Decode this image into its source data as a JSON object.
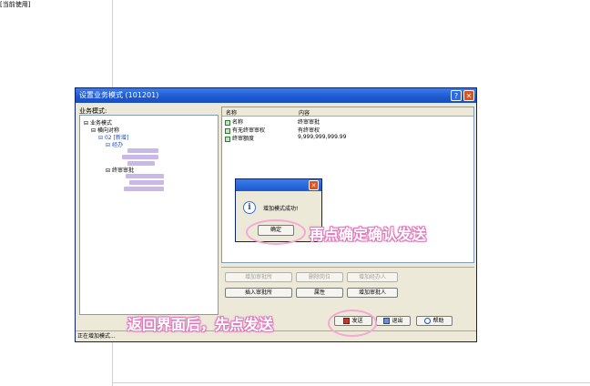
{
  "background": {
    "top_label": "[当前使用]"
  },
  "dialog": {
    "title": "设置业务模式 (101201)",
    "help_glyph": "?",
    "close_glyph": "✕",
    "tree_label": "业务模式:",
    "tree": [
      "业务模式",
      "横向对称",
      "02 [新增]",
      "经办",
      "终审审批"
    ],
    "grid": {
      "columns": [
        "名称",
        "内容"
      ],
      "rows": [
        {
          "name": "名称",
          "value": "终审审批"
        },
        {
          "name": "有无终审审权",
          "value": "有终审权"
        },
        {
          "name": "终审额度",
          "value": "9,999,999,999.99"
        }
      ]
    },
    "buttons_disabled": [
      "增加审批所",
      "删除岗位",
      "增加经办人"
    ],
    "buttons_enabled": [
      "插入审批所",
      "属性",
      "增加审批人"
    ],
    "send_label": "发送",
    "exit_label": "退出",
    "help_label": "帮助",
    "status": "正在增加模式..."
  },
  "message_box": {
    "text": "增加模式成功!",
    "ok_label": "确定",
    "close_glyph": "✕",
    "icon_glyph": "i"
  },
  "annotations": {
    "right": "再点确定确认发送",
    "bottom": "返回界面后，先点发送"
  },
  "colors": {
    "accent": "#1d58d0",
    "annotation": "#e07bbd",
    "ring": "#f6a7d3"
  }
}
